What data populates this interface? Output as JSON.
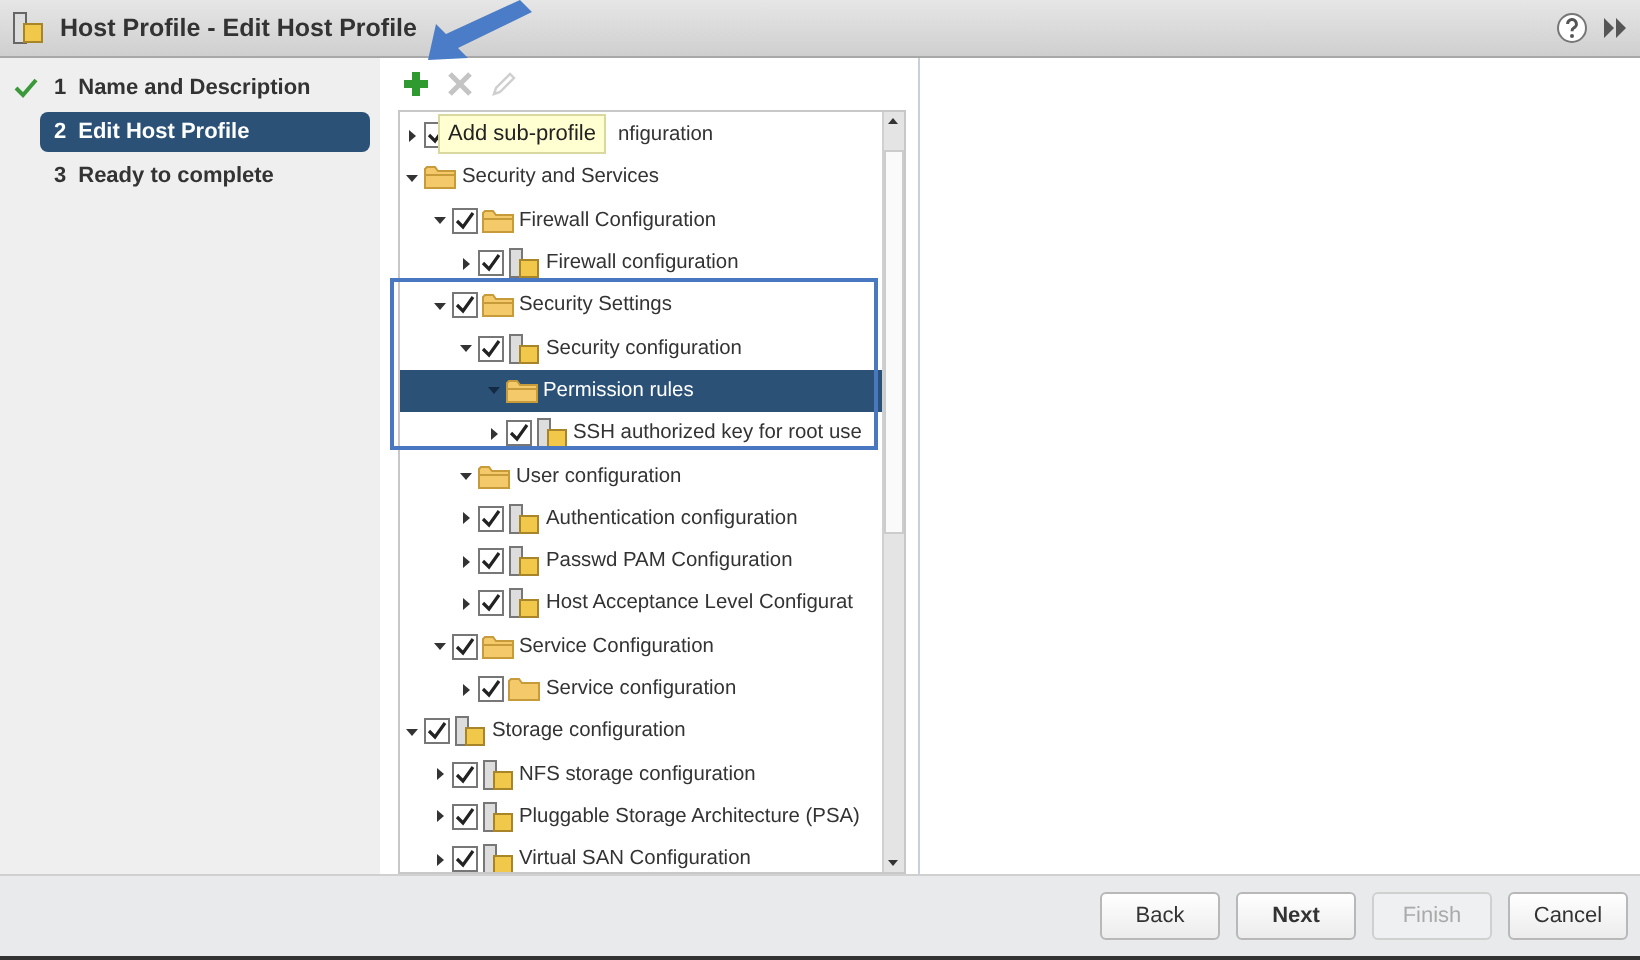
{
  "window": {
    "title": "Host Profile - Edit Host Profile"
  },
  "steps": [
    {
      "number": "1",
      "label": "Name and Description",
      "done": true,
      "selected": false
    },
    {
      "number": "2",
      "label": "Edit Host Profile",
      "done": false,
      "selected": true
    },
    {
      "number": "3",
      "label": "Ready to complete",
      "done": false,
      "selected": false
    }
  ],
  "toolbar": [
    {
      "kind": "add",
      "disabled": false
    },
    {
      "kind": "remove",
      "disabled": true
    },
    {
      "kind": "edit",
      "disabled": true
    }
  ],
  "tooltip": {
    "text": "Add sub-profile"
  },
  "tree": [
    {
      "label": "nfiguration",
      "checked": true,
      "expanded": false,
      "selected": false
    },
    {
      "label": "Security and Services",
      "kind": "folder",
      "expanded": true,
      "selected": false,
      "children": [
        {
          "label": "Firewall Configuration",
          "kind": "folder",
          "checked": true,
          "expanded": true,
          "selected": false,
          "children": [
            {
              "label": "Firewall configuration",
              "kind": "profile",
              "checked": true,
              "expanded": false,
              "selected": false
            }
          ]
        },
        {
          "label": "Security Settings",
          "kind": "folder",
          "checked": true,
          "expanded": true,
          "selected": false,
          "children": [
            {
              "label": "Security configuration",
              "kind": "profile",
              "checked": true,
              "expanded": true,
              "selected": false,
              "children": [
                {
                  "label": "Permission rules",
                  "kind": "folder",
                  "expanded": true,
                  "selected": true
                },
                {
                  "label": "SSH authorized key for root use",
                  "kind": "profile",
                  "checked": true,
                  "expanded": false,
                  "selected": false
                }
              ]
            },
            {
              "label": "User configuration",
              "kind": "folder",
              "expanded": true,
              "selected": false
            },
            {
              "label": "Authentication configuration",
              "kind": "profile",
              "checked": true,
              "expanded": false,
              "selected": false
            },
            {
              "label": "Passwd PAM Configuration",
              "kind": "profile",
              "checked": true,
              "expanded": false,
              "selected": false
            },
            {
              "label": "Host Acceptance Level Configurat",
              "kind": "profile",
              "checked": true,
              "expanded": false,
              "selected": false
            }
          ]
        },
        {
          "label": "Service Configuration",
          "kind": "folder",
          "checked": true,
          "expanded": true,
          "selected": false,
          "children": [
            {
              "label": "Service configuration",
              "kind": "folder",
              "checked": true,
              "expanded": false,
              "selected": false
            }
          ]
        }
      ]
    },
    {
      "label": "Storage configuration",
      "kind": "profile",
      "checked": true,
      "expanded": true,
      "selected": false,
      "children": [
        {
          "label": "NFS storage configuration",
          "kind": "profile",
          "checked": true,
          "expanded": false,
          "selected": false
        },
        {
          "label": "Pluggable Storage Architecture (PSA)",
          "kind": "profile",
          "checked": true,
          "expanded": false,
          "selected": false
        },
        {
          "label": "Virtual SAN Configuration",
          "kind": "profile",
          "checked": true,
          "expanded": false,
          "selected": false
        }
      ]
    }
  ],
  "buttons": [
    {
      "label": "Back",
      "primary": false,
      "disabled": false
    },
    {
      "label": "Next",
      "primary": true,
      "disabled": false
    },
    {
      "label": "Finish",
      "primary": false,
      "disabled": true
    },
    {
      "label": "Cancel",
      "primary": false,
      "disabled": false
    }
  ]
}
